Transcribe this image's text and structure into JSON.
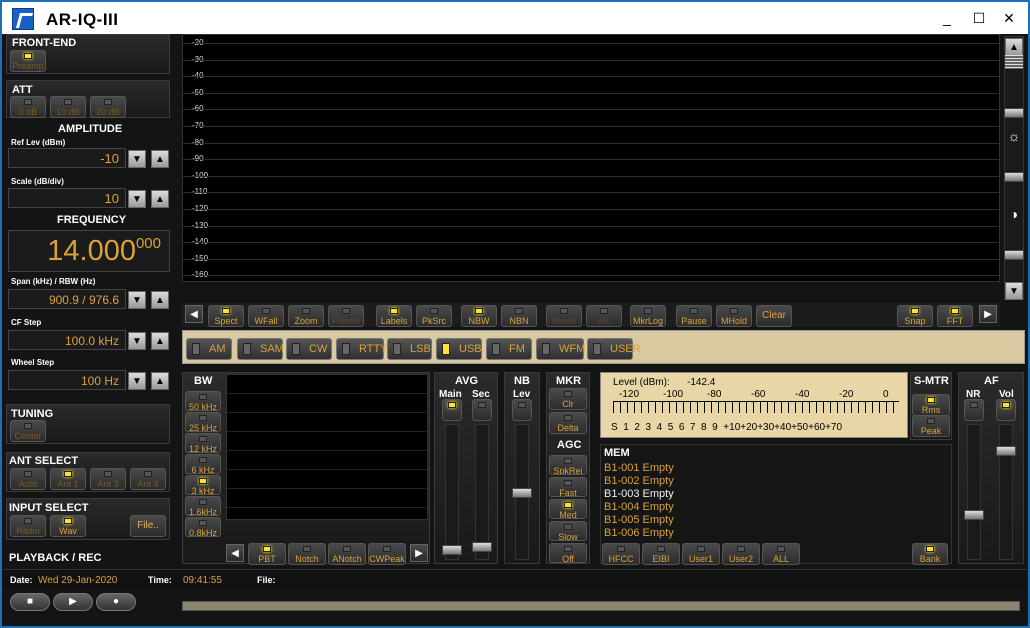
{
  "window": {
    "title": "AR-IQ-III",
    "minimize": "_",
    "maximize": "☐",
    "close": "✕"
  },
  "frontend": {
    "title": "FRONT-END",
    "preamp": "Preamp"
  },
  "att": {
    "title": "ATT",
    "buttons": [
      "0 dB",
      "10 dB",
      "20 dB"
    ]
  },
  "amplitude": {
    "title": "AMPLITUDE",
    "ref_label": "Ref Lev (dBm)",
    "ref_value": "-10",
    "scale_label": "Scale (dB/div)",
    "scale_value": "10"
  },
  "frequency": {
    "title": "FREQUENCY",
    "main": "14.000",
    "sub": "000",
    "span_label": "Span (kHz) / RBW (Hz)",
    "span_value": "900.9 / 976.6",
    "cf_label": "CF Step",
    "cf_value": "100.0 kHz",
    "wheel_label": "Wheel Step",
    "wheel_value": "100 Hz"
  },
  "tuning": {
    "title": "TUNING",
    "center": "Center"
  },
  "ant": {
    "title": "ANT SELECT",
    "buttons": [
      "Auto",
      "Ant 1",
      "Ant 3",
      "Ant 4"
    ]
  },
  "input": {
    "title": "INPUT SELECT",
    "buttons": [
      "Radio",
      "Wav"
    ],
    "file": "File.."
  },
  "playback": {
    "title": "PLAYBACK / REC"
  },
  "status": {
    "date_label": "Date:",
    "date_value": "Wed 29-Jan-2020",
    "time_label": "Time:",
    "time_value": "09:41:55",
    "file_label": "File:"
  },
  "spectrum": {
    "ylabels": [
      "-20",
      "-30",
      "-40",
      "-50",
      "-60",
      "-70",
      "-80",
      "-90",
      "-100",
      "-110",
      "-120",
      "-130",
      "-140",
      "-150",
      "-160"
    ]
  },
  "toolbar": {
    "buttons": [
      "Spect",
      "WFall",
      "Zoom",
      "Palette",
      "Labels",
      "PkSrc",
      "NBW",
      "NBN",
      "Mono",
      "Afc",
      "MkrLog",
      "Pause",
      "MHold",
      "Clear",
      "Snap",
      "FFT"
    ]
  },
  "modes": [
    "AM",
    "SAM",
    "CW",
    "RTTY",
    "LSB",
    "USB",
    "FM",
    "WFM",
    "USER"
  ],
  "bw": {
    "title": "BW",
    "buttons": [
      "50 kHz",
      "25 kHz",
      "12 kHz",
      "6 kHz",
      "3 kHz",
      "1.6kHz",
      "0.8kHz"
    ],
    "bottom": [
      "PBT",
      "Notch",
      "ANotch",
      "CWPeak"
    ]
  },
  "avg": {
    "title": "AVG",
    "main": "Main",
    "sec": "Sec"
  },
  "nb": {
    "title": "NB",
    "lev": "Lev"
  },
  "mkr": {
    "title": "MKR",
    "buttons": [
      "Clr",
      "Delta"
    ]
  },
  "agc": {
    "title": "AGC",
    "buttons": [
      "SpkRej",
      "Fast",
      "Med",
      "Slow",
      "Off"
    ]
  },
  "smeter": {
    "level_label": "Level (dBm):",
    "level_value": "-142.4",
    "dbm_scale": [
      "-120",
      "-100",
      "-80",
      "-60",
      "-40",
      "-20",
      "0"
    ],
    "s_scale": "S  1  2  3  4  5  6  7  8  9  +10+20+30+40+50+60+70"
  },
  "smtr": {
    "title": "S-MTR",
    "buttons": [
      "Rms",
      "Peak"
    ]
  },
  "af": {
    "title": "AF",
    "nr": "NR",
    "vol": "Vol"
  },
  "mem": {
    "title": "MEM",
    "items": [
      "B1-001 Empty",
      "B1-002 Empty",
      "B1-003 Empty",
      "B1-004 Empty",
      "B1-005 Empty",
      "B1-006 Empty"
    ],
    "buttons": [
      "HFCC",
      "EIBI",
      "User1",
      "User2",
      "ALL"
    ],
    "bank": "Bank"
  }
}
